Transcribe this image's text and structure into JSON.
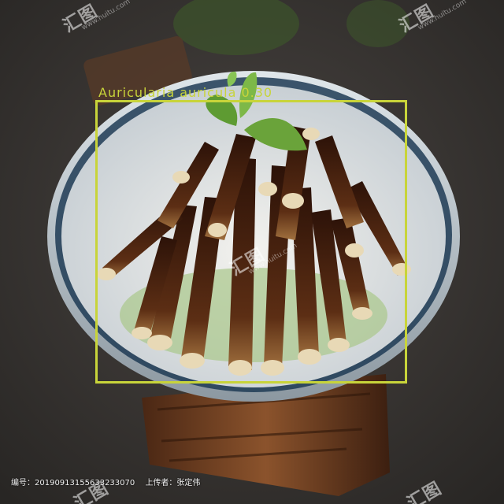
{
  "detection": {
    "label": "Auricularia auricula 0.30",
    "color": "#c8d43a"
  },
  "watermark": {
    "brand": "汇图",
    "site": "www.huitu.com"
  },
  "caption": {
    "id_text": "编号：20190913155633233070",
    "uploader_text": "上传者：张定伟"
  },
  "palette": {
    "background": "#3a3735",
    "bowl_rim": "#c9d3da",
    "wood": "#6b3a1f",
    "mushroom_dark": "#3c1a0c",
    "mushroom_tip": "#e8d9b6",
    "mint": "#6aa33a"
  }
}
